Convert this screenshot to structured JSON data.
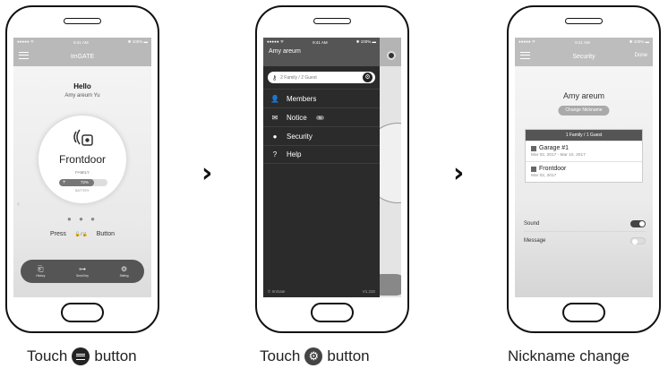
{
  "status": {
    "carrier": "●●●●● ᯤ",
    "time": "9:41 AM",
    "battery": "✱ 100% ▬"
  },
  "screen1": {
    "title": "ImGATE",
    "greeting": "Hello",
    "user": "Amy areum Yu",
    "door_name": "Frontdoor",
    "door_type": "FAMILY",
    "battery_percent": 72,
    "battery_text": "72%",
    "battery_label": "BATTERY",
    "page_dots": "● ● ●",
    "press_label": "Press",
    "lock_symbol": "🔓/🔒",
    "button_label": "Button",
    "bottom_items": [
      {
        "icon": "history-icon",
        "glyph": "⎗",
        "label": "History"
      },
      {
        "icon": "send-key-icon",
        "glyph": "⊶",
        "label": "Send Key"
      },
      {
        "icon": "setting-icon",
        "glyph": "⚙",
        "label": "Setting"
      }
    ]
  },
  "screen2": {
    "user_name": "Amy areum",
    "family_text": "2 Family / 2 Guest",
    "menu": [
      {
        "icon": "members-icon",
        "glyph": "👤",
        "label": "Members",
        "badge": ""
      },
      {
        "icon": "notice-icon",
        "glyph": "✉",
        "label": "Notice",
        "badge": "N"
      },
      {
        "icon": "security-icon",
        "glyph": "●",
        "label": "Security",
        "badge": ""
      },
      {
        "icon": "help-icon",
        "glyph": "?",
        "label": "Help",
        "badge": ""
      }
    ],
    "footer_left": "© ImGate",
    "footer_right": "V1.232"
  },
  "screen3": {
    "title": "Security",
    "done": "Done",
    "nickname": "Amy areum",
    "change_button": "Change Nickname",
    "card_header": "1 Family / 1 Guest",
    "doors": [
      {
        "name": "Garage #1",
        "dates": "Mar 02, 2017 - Mar 10, 2017"
      },
      {
        "name": "Frontdoor",
        "dates": "Mar 02, 2017"
      }
    ],
    "sound_label": "Sound",
    "sound_on": true,
    "message_label": "Message",
    "message_on": false
  },
  "captions": {
    "c1_pre": "Touch",
    "c1_post": "button",
    "c2_pre": "Touch",
    "c2_post": "button",
    "c3": "Nickname change"
  },
  "colors": {
    "accent": "#555555",
    "drawer": "#2b2b2b"
  }
}
